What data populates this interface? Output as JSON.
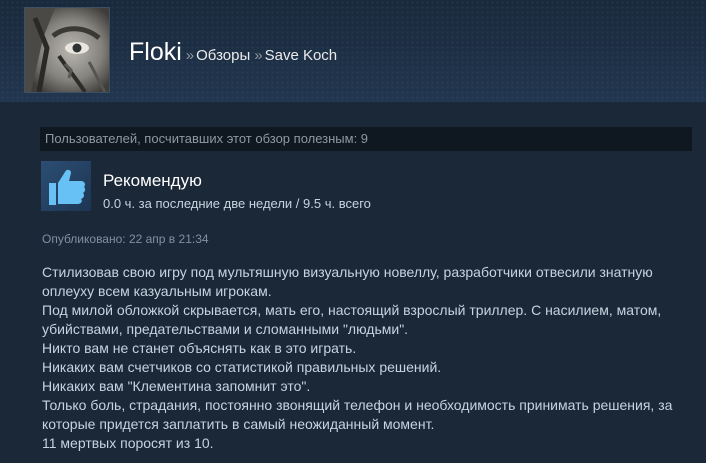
{
  "header": {
    "persona_name": "Floki",
    "separator": "»",
    "crumb_reviews": "Обзоры",
    "crumb_game": "Save Koch"
  },
  "review": {
    "helpful_text": "Пользователей, посчитавших этот обзор полезным: 9",
    "recommendation": "Рекомендую",
    "hours": "0.0 ч. за последние две недели / 9.5 ч. всего",
    "posted": "Опубликовано: 22 апр в 21:34",
    "lines": [
      "Стилизовав свою игру под мультяшную визуальную новеллу, разработчики отвесили знатную оплеуху всем казуальным игрокам.",
      "Под милой обложкой скрывается, мать его, настоящий взрослый триллер. С насилием, матом, убийствами, предательствами и сломанными \"людьми\".",
      "Никто вам не станет объяснять как в это играть.",
      "Никаких вам счетчиков со статистикой правильных решений.",
      "Никаких вам \"Клементина запомнит это\".",
      "Только боль, страдания, постоянно звонящий телефон и необходимость принимать решения, за которые придется заплатить в самый неожиданный момент.",
      "11 мертвых поросят из 10."
    ]
  },
  "colors": {
    "page_bg": "#1b2838",
    "helpful_bar_bg": "#0f1720",
    "thumb_bg": "#2c4e73",
    "thumb_icon": "#67c1f5",
    "text_main": "#c6d4df",
    "text_muted": "#8f98a0"
  },
  "icons": {
    "avatar": "avatar-image",
    "recommend": "thumbs-up-icon"
  }
}
